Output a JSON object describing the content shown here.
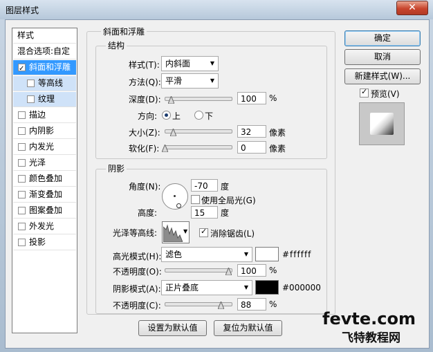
{
  "window": {
    "title": "图层样式",
    "close_glyph": "✕"
  },
  "style_list": {
    "header": "样式",
    "blending": "混合选项:自定",
    "items": [
      {
        "label": "斜面和浮雕",
        "checked": true
      },
      {
        "label": "等高线",
        "checked": false
      },
      {
        "label": "纹理",
        "checked": false
      },
      {
        "label": "描边",
        "checked": false
      },
      {
        "label": "内阴影",
        "checked": false
      },
      {
        "label": "内发光",
        "checked": false
      },
      {
        "label": "光泽",
        "checked": false
      },
      {
        "label": "颜色叠加",
        "checked": false
      },
      {
        "label": "渐变叠加",
        "checked": false
      },
      {
        "label": "图案叠加",
        "checked": false
      },
      {
        "label": "外发光",
        "checked": false
      },
      {
        "label": "投影",
        "checked": false
      }
    ]
  },
  "bevel": {
    "section_title": "斜面和浮雕",
    "structure": {
      "title": "结构",
      "style_label": "样式(T):",
      "style_value": "内斜面",
      "method_label": "方法(Q):",
      "method_value": "平滑",
      "depth_label": "深度(D):",
      "depth_value": "100",
      "depth_unit": "%",
      "depth_level": 0.1,
      "direction_label": "方向:",
      "dir_up": "上",
      "dir_down": "下",
      "size_label": "大小(Z):",
      "size_value": "32",
      "size_unit": "像素",
      "size_level": 0.13,
      "soften_label": "软化(F):",
      "soften_value": "0",
      "soften_unit": "像素",
      "soften_level": 0.0
    },
    "shading": {
      "title": "阴影",
      "angle_label": "角度(N):",
      "angle_value": "-70",
      "angle_unit": "度",
      "global_light": "使用全局光(G)",
      "altitude_label": "高度:",
      "altitude_value": "15",
      "altitude_unit": "度",
      "gloss_label": "光泽等高线:",
      "antialias": "消除锯齿(L)",
      "highlight_label": "高光模式(H):",
      "highlight_mode": "滤色",
      "highlight_color": "#ffffff",
      "highlight_hex": "#ffffff",
      "hl_opacity_label": "不透明度(O):",
      "hl_opacity_value": "100",
      "hl_opacity_unit": "%",
      "hl_opacity_level": 1.0,
      "shadow_label": "阴影模式(A):",
      "shadow_mode": "正片叠底",
      "shadow_color": "#000000",
      "shadow_hex": "#000000",
      "sh_opacity_label": "不透明度(C):",
      "sh_opacity_value": "88",
      "sh_opacity_unit": "%",
      "sh_opacity_level": 0.88
    },
    "make_default": "设置为默认值",
    "reset_default": "复位为默认值"
  },
  "right": {
    "ok": "确定",
    "cancel": "取消",
    "new_style": "新建样式(W)...",
    "preview": "预览(V)"
  },
  "watermark": {
    "line1": "fevte.com",
    "line2": "飞特教程网"
  }
}
